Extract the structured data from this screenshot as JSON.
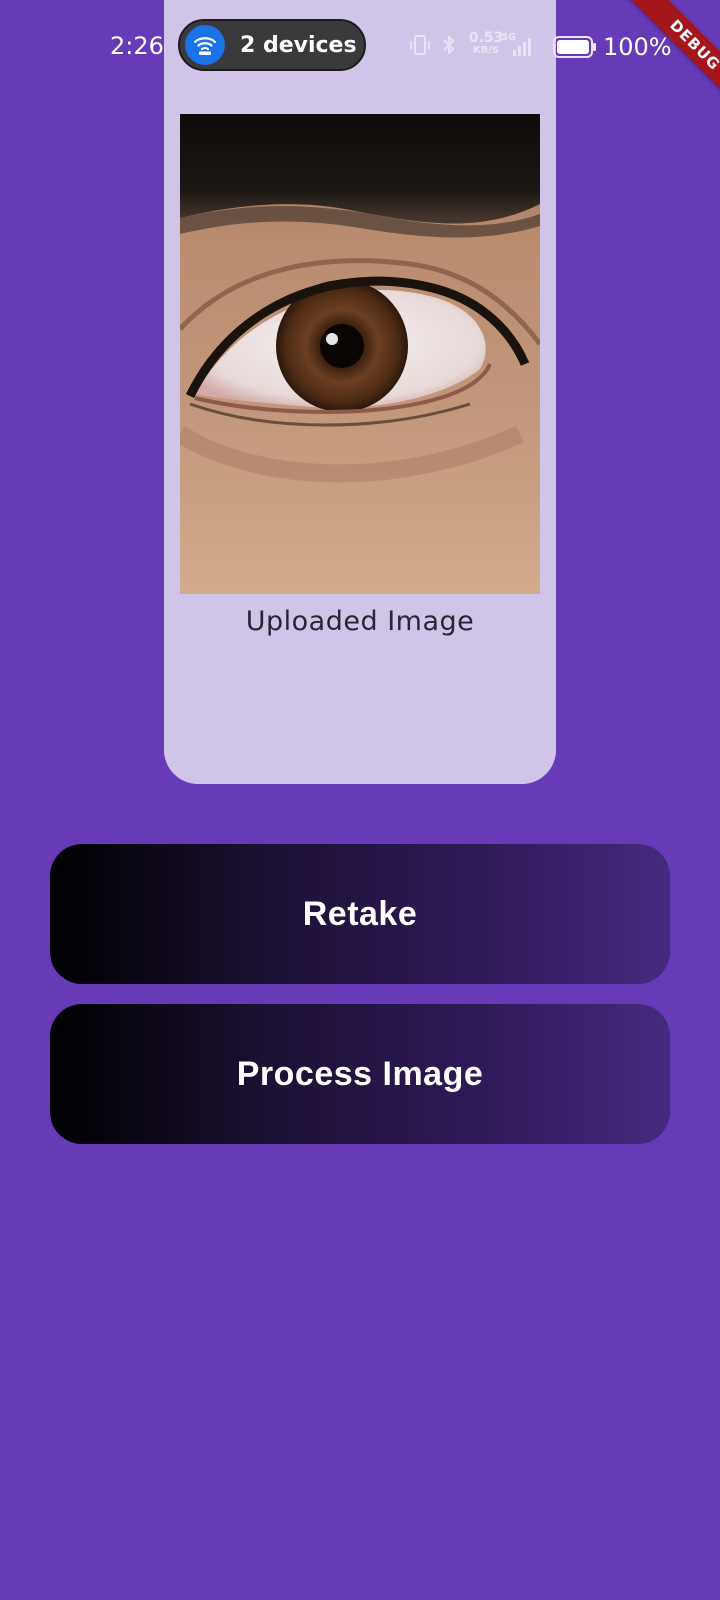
{
  "status_bar": {
    "time": "2:26",
    "hotspot_label": "2 devices",
    "network_speed_value": "0.53",
    "network_speed_unit": "KB/S",
    "network_type": "5G",
    "battery_percent": "100%"
  },
  "debug_banner": "DEBUG",
  "card": {
    "image_caption": "Uploaded Image"
  },
  "buttons": {
    "retake_label": "Retake",
    "process_label": "Process Image"
  },
  "colors": {
    "background": "#673ab7",
    "card": "#d1c4e9",
    "button_gradient_start": "#000000",
    "button_gradient_end": "#452a80",
    "debug_ribbon": "#a4161c",
    "hotspot_icon": "#1a73e8"
  },
  "icons": [
    "wifi-hotspot-icon",
    "vibrate-icon",
    "bluetooth-icon",
    "signal-icon",
    "battery-icon"
  ]
}
